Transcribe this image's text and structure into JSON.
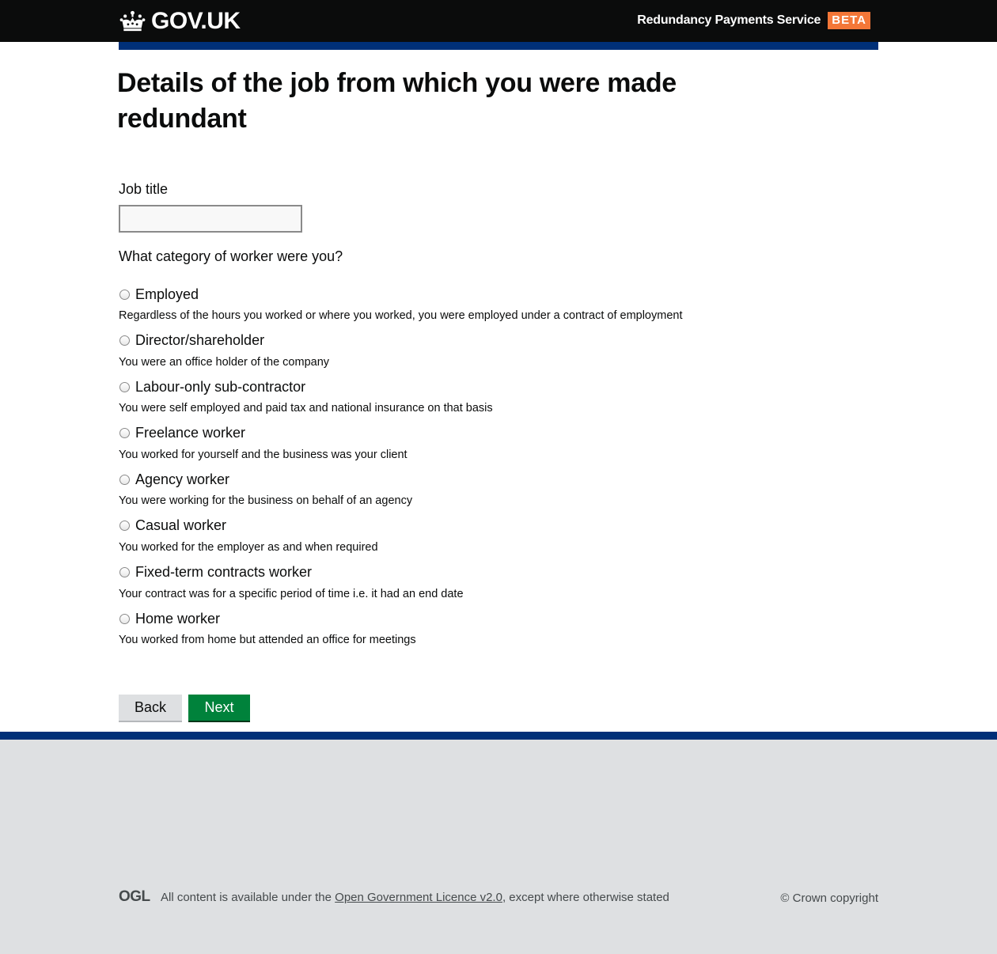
{
  "header": {
    "logo_text": "GOV.UK",
    "service_name": "Redundancy Payments Service",
    "phase_tag": "BETA"
  },
  "main": {
    "title": "Details of the job from which you were made redundant",
    "job_title_label": "Job title",
    "job_title_value": "",
    "category_legend": "What category of worker were you?",
    "options": [
      {
        "label": "Employed",
        "hint": "Regardless of the hours you worked or where you worked, you were employed under a contract of employment"
      },
      {
        "label": "Director/shareholder",
        "hint": "You were an office holder of the company"
      },
      {
        "label": "Labour-only sub-contractor",
        "hint": "You were self employed and paid tax and national insurance on that basis"
      },
      {
        "label": "Freelance worker",
        "hint": "You worked for yourself and the business was your client"
      },
      {
        "label": "Agency worker",
        "hint": "You were working for the business on behalf of an agency"
      },
      {
        "label": "Casual worker",
        "hint": "You worked for the employer as and when required"
      },
      {
        "label": "Fixed-term contracts worker",
        "hint": "Your contract was for a specific period of time i.e. it had an end date"
      },
      {
        "label": "Home worker",
        "hint": "You worked from home but attended an office for meetings"
      }
    ],
    "back_label": "Back",
    "next_label": "Next"
  },
  "footer": {
    "ogl_logo": "OGL",
    "licence_prefix": "All content is available under the",
    "licence_link": "Open Government Licence v2.0",
    "licence_suffix": ", except where otherwise stated",
    "copyright": "© Crown copyright"
  },
  "colors": {
    "header_bg": "#0b0c0c",
    "brand_blue": "#003078",
    "phase_tag": "#f47738",
    "next_button": "#00823b",
    "back_button": "#dee0e2",
    "footer_bg": "#dee0e2"
  },
  "icons": {
    "logo": "crown-icon",
    "radio": "radio-unchecked-icon"
  }
}
